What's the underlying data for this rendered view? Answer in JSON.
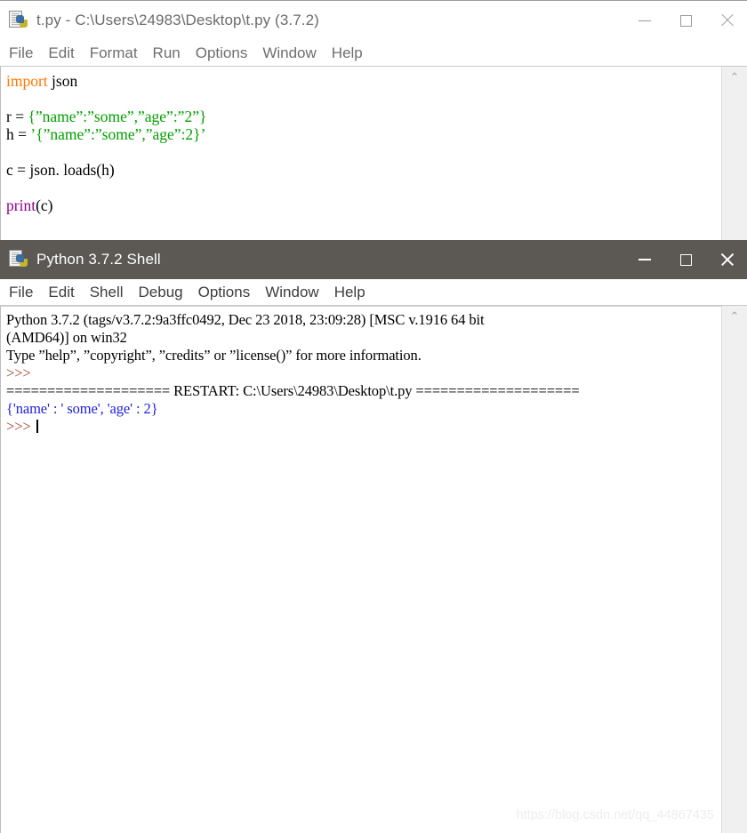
{
  "editor": {
    "title": "t.py - C:\\Users\\24983\\Desktop\\t.py (3.7.2)",
    "icon": "python-file-icon",
    "menu": [
      "File",
      "Edit",
      "Format",
      "Run",
      "Options",
      "Window",
      "Help"
    ],
    "controls": {
      "minimize": "minimize-icon",
      "maximize": "maximize-icon",
      "close": "close-icon"
    },
    "scroll_arrow": "⌃",
    "code": {
      "line1_kw": "import",
      "line1_rest": " json",
      "line2_prefix": "r = ",
      "line2_str": "{”name”:”some”,”age”:”2”}",
      "line3_prefix": "h = ",
      "line3_str": "’{”name”:”some”,”age”:2}’",
      "line4": "c = json. loads(h)",
      "line5_kw": "print",
      "line5_rest": "(c)"
    }
  },
  "shell": {
    "title": "Python 3.7.2 Shell",
    "icon": "python-file-icon",
    "menu": [
      "File",
      "Edit",
      "Shell",
      "Debug",
      "Options",
      "Window",
      "Help"
    ],
    "controls": {
      "minimize": "minimize-icon",
      "maximize": "maximize-icon",
      "close": "close-icon"
    },
    "scroll_arrow": "⌃",
    "output": {
      "banner_line1": "Python 3.7.2 (tags/v3.7.2:9a3ffc0492, Dec 23 2018, 23:09:28) [MSC v.1916 64 bit",
      "banner_line2": "(AMD64)] on win32",
      "banner_line3": "Type ”help”, ”copyright”, ”credits” or ”license()” for more information.",
      "prompt1": ">>>",
      "restart": "==================== RESTART: C:\\Users\\24983\\Desktop\\t.py ====================",
      "result": "{'name' : ' some', 'age' : 2}",
      "prompt2": ">>>"
    }
  },
  "watermark": "https://blog.csdn.net/qq_44867435",
  "colors": {
    "keyword": "#ff7700",
    "string": "#00a000",
    "builtin": "#900090",
    "shell_output": "#2020dd",
    "shell_prompt": "#a5402a",
    "shell_titlebar": "#5c5854"
  }
}
